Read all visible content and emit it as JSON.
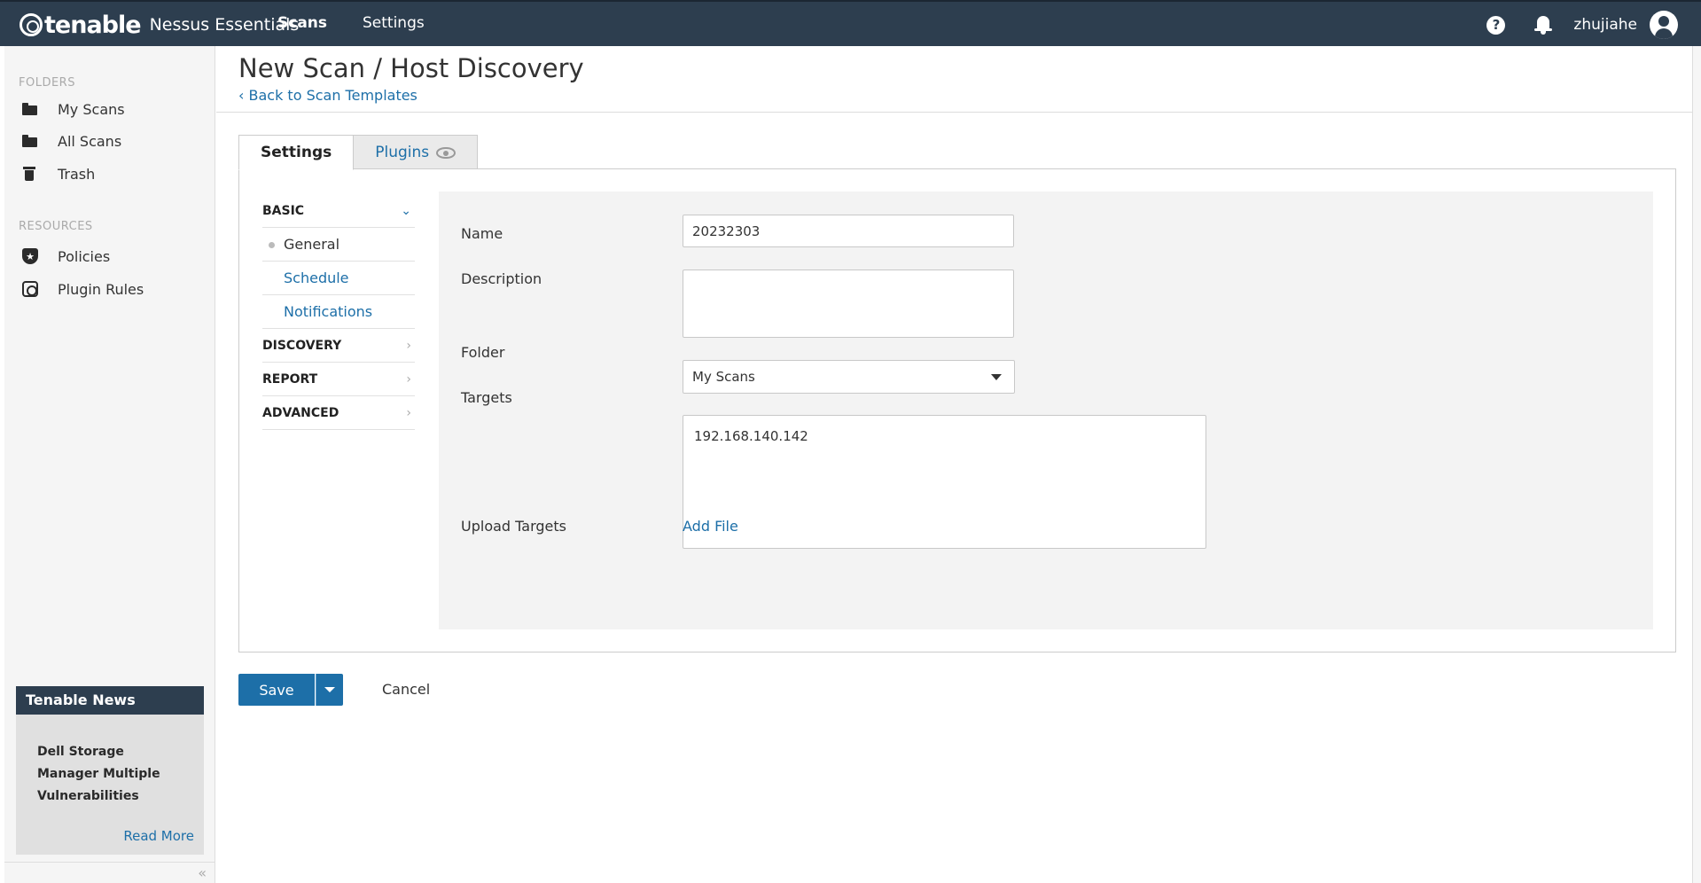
{
  "topbar": {
    "brand": "tenable",
    "product": "Nessus Essentials",
    "nav_scans": "Scans",
    "nav_settings": "Settings",
    "help": "?",
    "username": "zhujiahe"
  },
  "sidebar": {
    "folders_title": "FOLDERS",
    "folders": [
      "My Scans",
      "All Scans",
      "Trash"
    ],
    "resources_title": "RESOURCES",
    "resources": [
      "Policies",
      "Plugin Rules"
    ],
    "news": {
      "title": "Tenable News",
      "headline": "Dell Storage Manager Multiple Vulnerabilities",
      "read_more": "Read More"
    },
    "collapse": "«"
  },
  "header": {
    "title": "New Scan / Host Discovery",
    "back_link": "‹ Back to Scan Templates"
  },
  "tabs": [
    "Settings",
    "Plugins"
  ],
  "menu": {
    "basic": "BASIC",
    "basic_items": [
      "General",
      "Schedule",
      "Notifications"
    ],
    "discovery": "DISCOVERY",
    "report": "REPORT",
    "advanced": "ADVANCED"
  },
  "form": {
    "name_label": "Name",
    "name_value": "20232303",
    "description_label": "Description",
    "description_value": "",
    "folder_label": "Folder",
    "folder_value": "My Scans",
    "targets_label": "Targets",
    "targets_value": "192.168.140.142",
    "upload_label": "Upload Targets",
    "add_file": "Add File"
  },
  "actions": {
    "save": "Save",
    "cancel": "Cancel"
  },
  "colors": {
    "topbar": "#2d3e4f",
    "accent": "#1d6fa8"
  }
}
